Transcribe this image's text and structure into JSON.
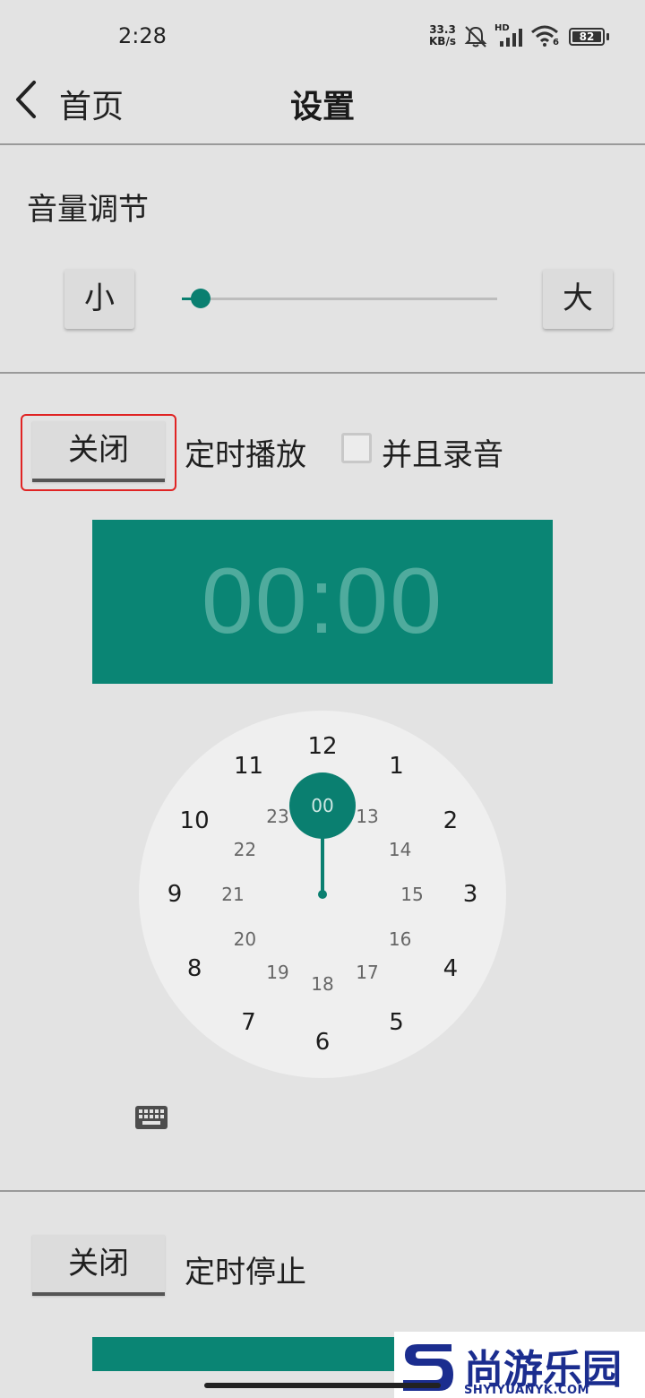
{
  "status_bar": {
    "time": "2:28",
    "net_speed_value": "33.3",
    "net_speed_unit": "KB/s",
    "signal_label": "HD",
    "wifi_label": "6",
    "battery": "82"
  },
  "header": {
    "back_label": "首页",
    "title": "设置"
  },
  "volume": {
    "title": "音量调节",
    "down_label": "小",
    "up_label": "大",
    "level": 0.06
  },
  "timed_play": {
    "toggle_label": "关闭",
    "label": "定时播放",
    "record_label": "并且录音",
    "record_checked": false,
    "time": "00:00"
  },
  "clock": {
    "selected": "00",
    "outer": [
      "12",
      "1",
      "2",
      "3",
      "4",
      "5",
      "6",
      "7",
      "8",
      "9",
      "10",
      "11"
    ],
    "inner": [
      "13",
      "14",
      "15",
      "16",
      "17",
      "18",
      "19",
      "20",
      "21",
      "22",
      "23"
    ]
  },
  "timed_stop": {
    "toggle_label": "关闭",
    "label": "定时停止"
  },
  "watermark": {
    "title": "尚游乐园",
    "subtitle": "SHYIYUANYK.COM"
  },
  "colors": {
    "accent": "#0a8574",
    "highlight": "#e02424"
  }
}
